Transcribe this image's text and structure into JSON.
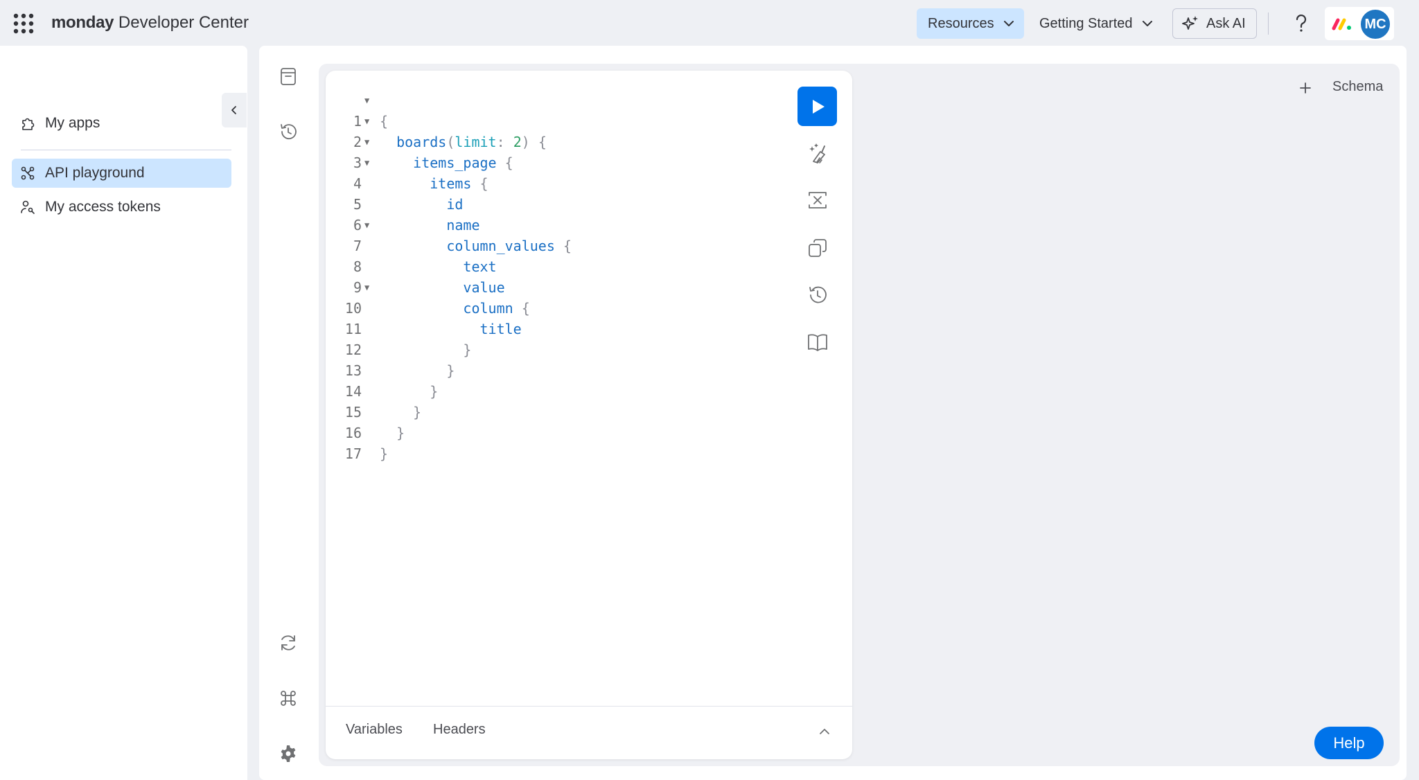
{
  "topbar": {
    "brand_bold": "monday",
    "brand_rest": " Developer Center",
    "resources_label": "Resources",
    "getting_started_label": "Getting Started",
    "ask_ai_label": "Ask AI",
    "avatar_initials": "MC"
  },
  "sidebar": {
    "items": [
      {
        "label": "My apps",
        "icon": "puzzle-icon"
      },
      {
        "label": "API playground",
        "icon": "graph-nodes-icon",
        "active": true
      },
      {
        "label": "My access tokens",
        "icon": "key-person-icon"
      }
    ]
  },
  "playground": {
    "left_icons": [
      "archive-icon",
      "history-icon",
      "refresh-icon",
      "command-icon",
      "gear-icon"
    ],
    "tools": [
      "run-icon",
      "prettify-icon",
      "merge-icon",
      "copy-icon",
      "history-icon",
      "docs-icon"
    ],
    "code": {
      "line_numbers": [
        "1",
        "2",
        "3",
        "4",
        "5",
        "6",
        "7",
        "8",
        "9",
        "10",
        "11",
        "12",
        "13",
        "14",
        "15",
        "16",
        "17"
      ],
      "folds": [
        true,
        true,
        true,
        true,
        false,
        false,
        true,
        false,
        false,
        true,
        false,
        false,
        false,
        false,
        false,
        false,
        false
      ]
    },
    "footer": {
      "variables_label": "Variables",
      "headers_label": "Headers"
    },
    "schema_label": "Schema",
    "help_label": "Help"
  },
  "colors": {
    "accent": "#0073ea",
    "selected_bg": "#cce5ff",
    "avatar": "#1f76c2"
  }
}
